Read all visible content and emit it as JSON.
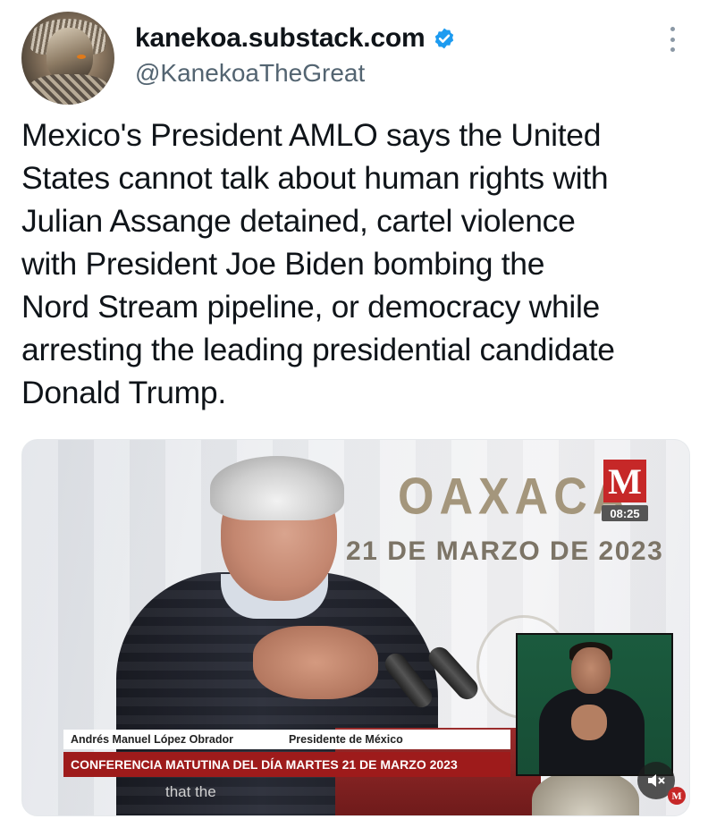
{
  "tweet": {
    "display_name": "kanekoa.substack.com",
    "handle": "@KanekoaTheGreat",
    "verified": true,
    "text": "Mexico's President AMLO says the United\nStates cannot talk about human rights with\nJulian Assange detained, cartel violence\nwith President Joe Biden bombing the\nNord Stream pipeline, or democracy while\narresting the leading presidential candidate\nDonald Trump."
  },
  "media": {
    "location": "OAXACA",
    "date": "21 DE MARZO DE 2023",
    "logo_letter": "M",
    "timestamp": "08:25",
    "lower_third_name": "Andrés Manuel López Obrador",
    "lower_third_role": "Presidente de México",
    "lower_third_title": "CONFERENCIA MATUTINA DEL DÍA MARTES 21 DE MARZO 2023",
    "caption": "that the",
    "corner_logo": "M"
  },
  "icons": {
    "verified": "verified-badge-icon",
    "more": "more-options-icon",
    "mute": "muted-speaker-icon"
  },
  "colors": {
    "verified_blue": "#1d9bf0",
    "handle_gray": "#536471",
    "brand_red": "#c62828",
    "lower_third_red": "#9e1b1b"
  }
}
